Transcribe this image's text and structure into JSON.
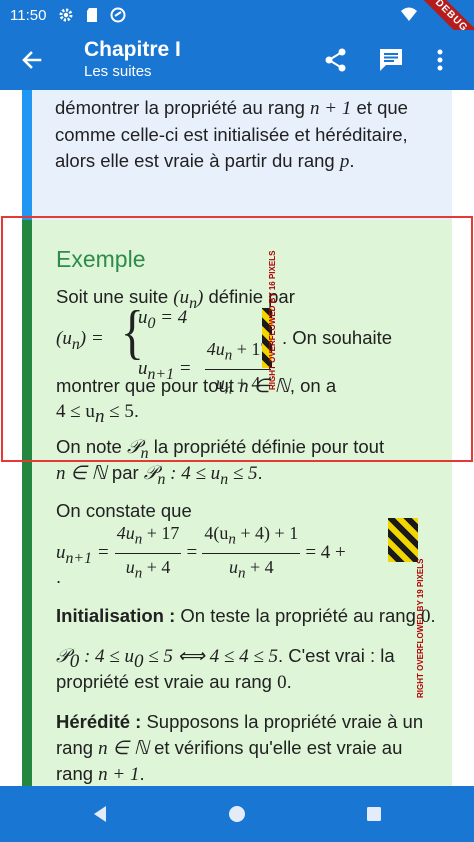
{
  "status_bar": {
    "time": "11:50",
    "icons": [
      "gear-icon",
      "sd-card-icon",
      "do-not-disturb-icon",
      "wifi-icon",
      "signal-icon",
      "battery-icon"
    ],
    "debug_banner": "DEBUG"
  },
  "app_bar": {
    "title": "Chapitre I",
    "subtitle": "Les suites",
    "back_icon": "arrow-back-icon",
    "actions": [
      "share-icon",
      "comment-icon",
      "more-vert-icon"
    ],
    "color": "#1976d2"
  },
  "blue_block": {
    "line1_a": "démontrer la propriété au rang",
    "line1_math": "n + 1",
    "line1_b": "et que",
    "line2": "comme celle-ci est initialisée et héréditaire,",
    "line3_a": "alors elle est vraie à partir du rang",
    "line3_math": "p",
    "line3_b": ".",
    "accent": "#2196f3"
  },
  "example": {
    "title": "Exemple",
    "accent": "#25873f",
    "p1_a": "Soit une suite",
    "p1_math": "(u",
    "p1_sub": "n",
    "p1_math_end": ")",
    "p1_b": "définie par",
    "def_lhs": "(u",
    "def_lhs_sub": "n",
    "def_lhs_end": ") =",
    "case1": "u",
    "case1_sub": "0",
    "case1_val": " = 4",
    "case2": "u",
    "case2_sub": "n+1",
    "case2_eq": " =",
    "case2_num": "4u",
    "case2_num_sub": "n",
    "case2_num_end": " + 17",
    "case2_den": "u",
    "case2_den_sub": "n",
    "case2_den_end": " + 4",
    "p2_after": ". On souhaite",
    "p3_a": "montrer que pour tout",
    "p3_math": "n ∈ ℕ",
    "p3_b": ", on a",
    "p4_math": "4 ≤ u",
    "p4_sub": "n",
    "p4_math_end": " ≤ 5",
    "p4_b": ".",
    "p5_a": "On note",
    "p5_math": "𝒫",
    "p5_sub": "n",
    "p5_b": "la propriété définie pour tout",
    "p6_math": "n ∈ ℕ",
    "p6_a": "par",
    "p6_math2": "𝒫",
    "p6_sub": "n",
    "p6_math2_end": " : 4 ≤ u",
    "p6_sub2": "n",
    "p6_math2_end2": " ≤ 5",
    "p6_b": ".",
    "p7": "On constate que",
    "eq_lhs": "u",
    "eq_lhs_sub": "n+1",
    "eq_eq1": " =",
    "eq_f1_num": "4u",
    "eq_f1_num_sub": "n",
    "eq_f1_num_end": " + 17",
    "eq_f1_den": "u",
    "eq_f1_den_sub": "n",
    "eq_f1_den_end": " + 4",
    "eq_eq2": " =",
    "eq_f2_num": "4(u",
    "eq_f2_num_sub": "n",
    "eq_f2_num_end": " + 4) + 1",
    "eq_f2_den": "u",
    "eq_f2_den_sub": "n",
    "eq_f2_den_end": " + 4",
    "eq_eq3": " = 4 +",
    "eq_dot": ".",
    "init_label": "Initialisation :",
    "init_text": " On teste la propriété au rang",
    "init_math": "0",
    "init_end": ".",
    "p8_math": "𝒫",
    "p8_sub": "0",
    "p8_math_end": " : 4 ≤ u",
    "p8_sub2": "0",
    "p8_math_end2": " ≤ 5  ⟺  4 ≤ 4 ≤ 5",
    "p8_b": ". C'est vrai : la",
    "p9_a": "propriété est vraie au rang",
    "p9_math": "0",
    "p9_b": ".",
    "hered_label": "Hérédité :",
    "hered_text": " Supposons la propriété vraie à un",
    "p10_a": "rang",
    "p10_math": "n ∈ ℕ",
    "p10_b": "et vérifions qu'elle est vraie au",
    "p11_a": "rang",
    "p11_math": "n + 1",
    "p11_b": "."
  },
  "overflow_labels": {
    "label1": "RIGHT OVERFLOWED BY 16 PIXELS",
    "label2": "RIGHT OVERFLOWED BY 19 PIXELS"
  },
  "nav_bar": {
    "buttons": [
      "back-triangle-icon",
      "home-circle-icon",
      "recents-square-icon"
    ]
  }
}
